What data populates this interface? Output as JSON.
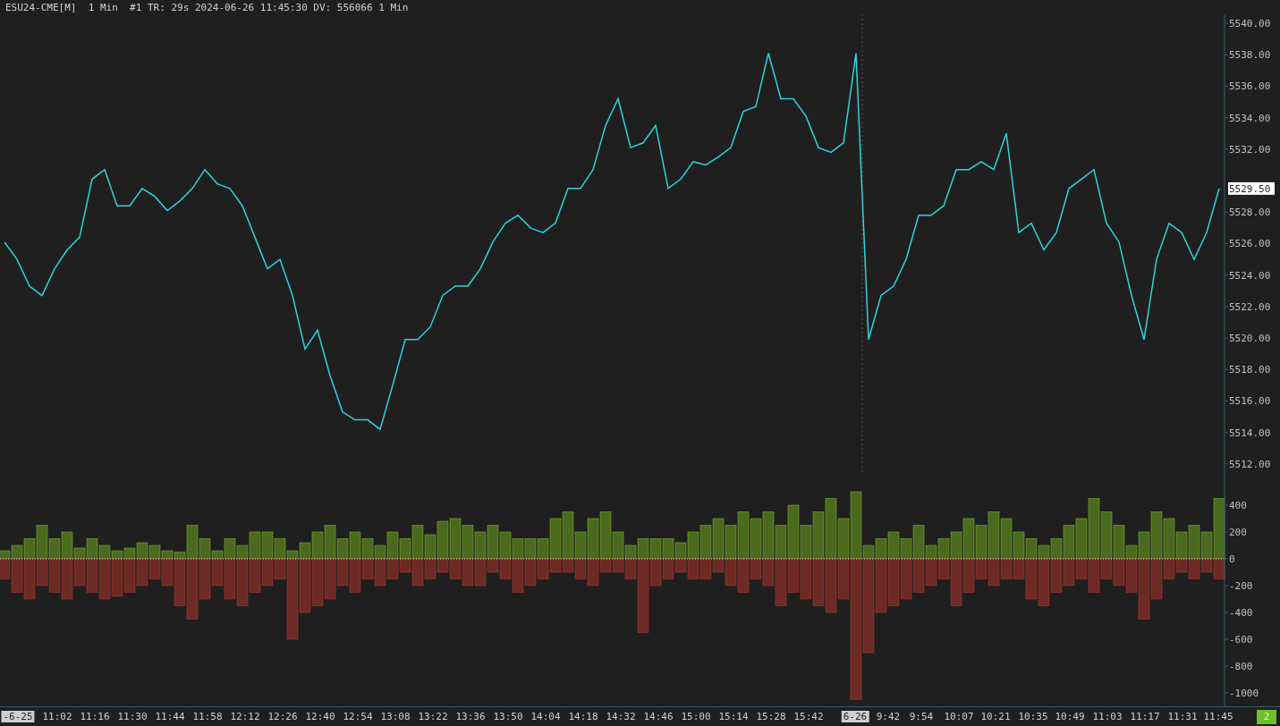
{
  "title_bar": {
    "text": "ESU24-CME[M]  1 Min  #1 TR: 29s 2024-06-26 11:45:30 DV: 556066 1 Min"
  },
  "price_panel": {
    "last_price": "5529.50",
    "chart_data": {
      "type": "line",
      "ylim": [
        5510.8,
        5540.57
      ],
      "yticks": [
        {
          "value": 5540,
          "label": "5540.00"
        },
        {
          "value": 5538,
          "label": "5538.00"
        },
        {
          "value": 5536,
          "label": "5536.00"
        },
        {
          "value": 5534,
          "label": "5534.00"
        },
        {
          "value": 5532,
          "label": "5532.00"
        },
        {
          "value": 5528,
          "label": "5528.00"
        },
        {
          "value": 5526,
          "label": "5526.00"
        },
        {
          "value": 5524,
          "label": "5524.00"
        },
        {
          "value": 5522,
          "label": "5522.00"
        },
        {
          "value": 5520,
          "label": "5520.00"
        },
        {
          "value": 5518,
          "label": "5518.00"
        },
        {
          "value": 5516,
          "label": "5516.00"
        },
        {
          "value": 5514,
          "label": "5514.00"
        },
        {
          "value": 5512,
          "label": "5512.00"
        }
      ],
      "series": [
        {
          "color": "#2fd3e0",
          "values": [
            5526.1,
            5525.0,
            5523.3,
            5522.7,
            5524.4,
            5525.6,
            5526.4,
            5530.1,
            5530.7,
            5528.4,
            5528.4,
            5529.5,
            5529.0,
            5528.1,
            5528.7,
            5529.5,
            5530.7,
            5529.8,
            5529.5,
            5528.4,
            5526.4,
            5524.4,
            5525.0,
            5522.7,
            5519.3,
            5520.5,
            5517.6,
            5515.3,
            5514.8,
            5514.8,
            5514.2,
            5517.0,
            5519.9,
            5519.9,
            5520.7,
            5522.7,
            5523.3,
            5523.3,
            5524.4,
            5526.1,
            5527.3,
            5527.8,
            5527.0,
            5526.7,
            5527.3,
            5529.5,
            5529.5,
            5530.7,
            5533.5,
            5535.2,
            5532.1,
            5532.4,
            5533.5,
            5529.5,
            5530.1,
            5531.2,
            5531.0,
            5531.5,
            5532.1,
            5534.4,
            5534.7,
            5538.1,
            5535.2,
            5535.2,
            5534.1,
            5532.1,
            5531.8,
            5532.4,
            5538.1,
            5519.9,
            5522.7,
            5523.3,
            5525.0,
            5527.8,
            5527.8,
            5528.4,
            5530.7,
            5530.7,
            5531.2,
            5530.7,
            5533.0,
            5526.7,
            5527.3,
            5525.6,
            5526.7,
            5529.5,
            5530.1,
            5530.7,
            5527.3,
            5526.1,
            5522.7,
            5519.9,
            5525.0,
            5527.3,
            5526.7,
            5525.0,
            5526.7,
            5529.5
          ]
        }
      ]
    }
  },
  "time_axis": {
    "labels": [
      {
        "text": "-6-25",
        "kind": "date"
      },
      {
        "text": "11:02",
        "kind": "time"
      },
      {
        "text": "11:16",
        "kind": "time"
      },
      {
        "text": "11:30",
        "kind": "time"
      },
      {
        "text": "11:44",
        "kind": "time"
      },
      {
        "text": "11:58",
        "kind": "time"
      },
      {
        "text": "12:12",
        "kind": "time"
      },
      {
        "text": "12:26",
        "kind": "time"
      },
      {
        "text": "12:40",
        "kind": "time"
      },
      {
        "text": "12:54",
        "kind": "time"
      },
      {
        "text": "13:08",
        "kind": "time"
      },
      {
        "text": "13:22",
        "kind": "time"
      },
      {
        "text": "13:36",
        "kind": "time"
      },
      {
        "text": "13:50",
        "kind": "time"
      },
      {
        "text": "14:04",
        "kind": "time"
      },
      {
        "text": "14:18",
        "kind": "time"
      },
      {
        "text": "14:32",
        "kind": "time"
      },
      {
        "text": "14:46",
        "kind": "time"
      },
      {
        "text": "15:00",
        "kind": "time"
      },
      {
        "text": "15:14",
        "kind": "time"
      },
      {
        "text": "15:28",
        "kind": "time"
      },
      {
        "text": "15:42",
        "kind": "time"
      },
      {
        "text": "6-26",
        "kind": "date"
      },
      {
        "text": "9:42",
        "kind": "time"
      },
      {
        "text": "9:54",
        "kind": "time"
      },
      {
        "text": "10:07",
        "kind": "time"
      },
      {
        "text": "10:21",
        "kind": "time"
      },
      {
        "text": "10:35",
        "kind": "time"
      },
      {
        "text": "10:49",
        "kind": "time"
      },
      {
        "text": "11:03",
        "kind": "time"
      },
      {
        "text": "11:17",
        "kind": "time"
      },
      {
        "text": "11:31",
        "kind": "time"
      },
      {
        "text": "11:45",
        "kind": "time"
      }
    ]
  },
  "delta_panel": {
    "chart_data": {
      "type": "bar",
      "stacked": true,
      "ylim": [
        -1100,
        566.7
      ],
      "yticks": [
        {
          "value": 400,
          "label": "400"
        },
        {
          "value": 200,
          "label": "200"
        },
        {
          "value": 0,
          "label": "0"
        },
        {
          "value": -200,
          "label": "-200"
        },
        {
          "value": -400,
          "label": "-400"
        },
        {
          "value": -600,
          "label": "-600"
        },
        {
          "value": -800,
          "label": "-800"
        },
        {
          "value": -1000,
          "label": "-1000"
        }
      ],
      "series": [
        {
          "color": "#4a6a1e",
          "values": [
            60,
            100,
            150,
            250,
            150,
            200,
            80,
            150,
            100,
            60,
            80,
            120,
            100,
            60,
            50,
            250,
            150,
            60,
            150,
            100,
            200,
            200,
            150,
            60,
            120,
            200,
            250,
            150,
            200,
            150,
            100,
            200,
            150,
            250,
            180,
            280,
            300,
            250,
            200,
            250,
            200,
            150,
            150,
            150,
            300,
            350,
            200,
            300,
            350,
            200,
            100,
            150,
            150,
            150,
            120,
            200,
            250,
            300,
            250,
            350,
            300,
            350,
            250,
            400,
            250,
            350,
            450,
            300,
            500,
            100,
            150,
            200,
            150,
            250,
            100,
            150,
            200,
            300,
            250,
            350,
            300,
            200,
            150,
            100,
            150,
            250,
            300,
            450,
            350,
            250,
            100,
            200,
            350,
            300,
            200,
            250,
            200,
            450
          ]
        },
        {
          "color": "#6e2a25",
          "values": [
            -150,
            -250,
            -300,
            -200,
            -250,
            -300,
            -200,
            -250,
            -300,
            -280,
            -250,
            -200,
            -150,
            -200,
            -350,
            -450,
            -300,
            -200,
            -300,
            -350,
            -250,
            -200,
            -150,
            -600,
            -400,
            -350,
            -300,
            -200,
            -250,
            -150,
            -200,
            -150,
            -100,
            -200,
            -150,
            -100,
            -150,
            -200,
            -200,
            -100,
            -150,
            -250,
            -200,
            -150,
            -100,
            -100,
            -150,
            -200,
            -100,
            -100,
            -150,
            -550,
            -200,
            -150,
            -100,
            -150,
            -150,
            -100,
            -200,
            -250,
            -150,
            -200,
            -350,
            -250,
            -300,
            -350,
            -400,
            -300,
            -1050,
            -700,
            -400,
            -350,
            -300,
            -250,
            -200,
            -150,
            -350,
            -250,
            -150,
            -200,
            -150,
            -150,
            -300,
            -350,
            -250,
            -200,
            -150,
            -250,
            -150,
            -200,
            -250,
            -450,
            -300,
            -150,
            -100,
            -150,
            -100,
            -150
          ]
        }
      ]
    }
  },
  "status_badge": "2"
}
